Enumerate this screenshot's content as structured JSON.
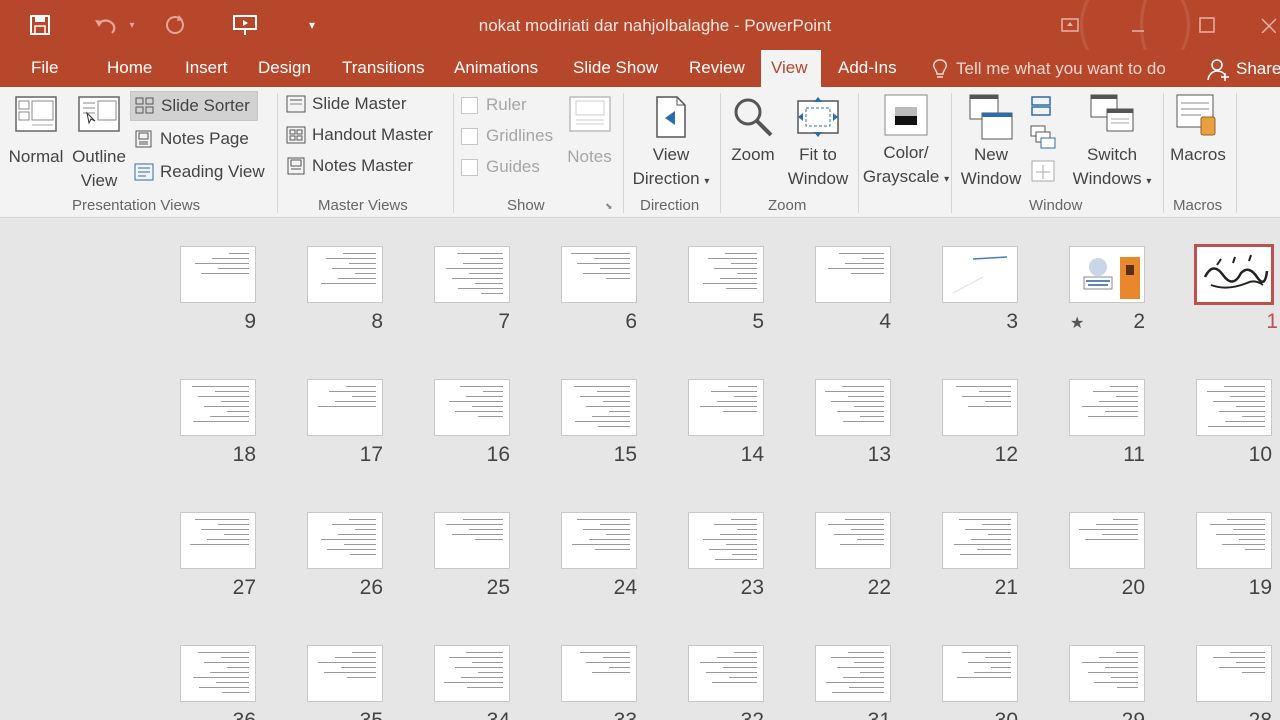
{
  "window": {
    "title": "nokat modiriati dar nahjolbalaghe - PowerPoint"
  },
  "qat": {
    "save_icon": "save-icon",
    "undo_icon": "undo-icon",
    "redo_icon": "redo-icon",
    "present_icon": "present-from-beginning-icon",
    "customize_icon": "customize-qat-icon"
  },
  "tabs": [
    "File",
    "Home",
    "Insert",
    "Design",
    "Transitions",
    "Animations",
    "Slide Show",
    "Review",
    "View",
    "Add-Ins"
  ],
  "active_tab": "View",
  "tell_me": "Tell me what you want to do",
  "share": "Share",
  "ribbon": {
    "presentation_views": {
      "label": "Presentation Views",
      "normal": "Normal",
      "outline_1": "Outline",
      "outline_2": "View",
      "slide_sorter": "Slide Sorter",
      "notes_page": "Notes Page",
      "reading_view": "Reading View"
    },
    "master_views": {
      "label": "Master Views",
      "slide_master": "Slide Master",
      "handout_master": "Handout Master",
      "notes_master": "Notes Master"
    },
    "show": {
      "label": "Show",
      "ruler": "Ruler",
      "gridlines": "Gridlines",
      "guides": "Guides",
      "notes": "Notes"
    },
    "direction": {
      "label": "Direction",
      "view_direction_1": "View",
      "view_direction_2": "Direction"
    },
    "zoom": {
      "label": "Zoom",
      "zoom": "Zoom",
      "fit_1": "Fit to",
      "fit_2": "Window"
    },
    "color": {
      "line1": "Color/",
      "line2": "Grayscale"
    },
    "window": {
      "label": "Window",
      "new_1": "New",
      "new_2": "Window",
      "switch_1": "Switch",
      "switch_2": "Windows"
    },
    "macros": {
      "label": "Macros",
      "macros": "Macros"
    }
  },
  "slides": [
    {
      "num": "9"
    },
    {
      "num": "8"
    },
    {
      "num": "7"
    },
    {
      "num": "6"
    },
    {
      "num": "5"
    },
    {
      "num": "4"
    },
    {
      "num": "3"
    },
    {
      "num": "2"
    },
    {
      "num": "1"
    },
    {
      "num": "18"
    },
    {
      "num": "17"
    },
    {
      "num": "16"
    },
    {
      "num": "15"
    },
    {
      "num": "14"
    },
    {
      "num": "13"
    },
    {
      "num": "12"
    },
    {
      "num": "11"
    },
    {
      "num": "10"
    },
    {
      "num": "27"
    },
    {
      "num": "26"
    },
    {
      "num": "25"
    },
    {
      "num": "24"
    },
    {
      "num": "23"
    },
    {
      "num": "22"
    },
    {
      "num": "21"
    },
    {
      "num": "20"
    },
    {
      "num": "19"
    },
    {
      "num": "36"
    },
    {
      "num": "35"
    },
    {
      "num": "34"
    },
    {
      "num": "33"
    },
    {
      "num": "32"
    },
    {
      "num": "31"
    },
    {
      "num": "30"
    },
    {
      "num": "29"
    },
    {
      "num": "28"
    }
  ],
  "selected_slide": "1",
  "colors": {
    "accent": "#b7472a",
    "selection": "#c0504d"
  }
}
